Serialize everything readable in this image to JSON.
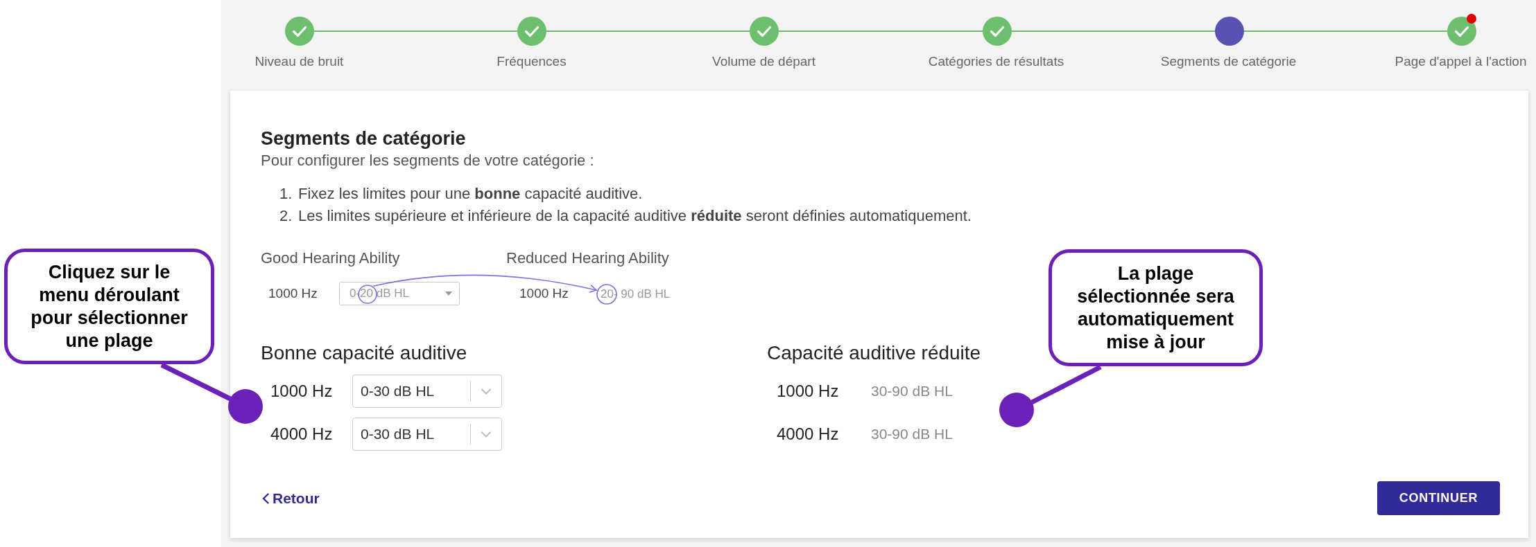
{
  "stepper": {
    "steps": [
      {
        "label": "Niveau de bruit",
        "completed": true,
        "selected": false,
        "alert": false
      },
      {
        "label": "Fréquences",
        "completed": true,
        "selected": false,
        "alert": false
      },
      {
        "label": "Volume de départ",
        "completed": true,
        "selected": false,
        "alert": false
      },
      {
        "label": "Catégories de résultats",
        "completed": true,
        "selected": false,
        "alert": false
      },
      {
        "label": "Segments de catégorie",
        "completed": false,
        "selected": true,
        "alert": false
      },
      {
        "label": "Page d'appel à l'action",
        "completed": true,
        "selected": false,
        "alert": true
      }
    ]
  },
  "card": {
    "title": "Segments de catégorie",
    "intro": "Pour configurer les segments de votre catégorie :",
    "instructions": [
      {
        "number": "1.",
        "text": "Fixez les limites pour une **bonne** capacité auditive."
      },
      {
        "number": "2.",
        "text": "Les limites supérieure et inférieure de la capacité auditive **réduite** seront définies automatiquement."
      }
    ],
    "example": {
      "columns": [
        {
          "title": "Good Hearing Ability",
          "rows": [
            {
              "frequency": "1000 Hz",
              "value": "0-20 dB HL",
              "kind": "dropdown"
            }
          ]
        },
        {
          "title": "Reduced Hearing Ability",
          "rows": [
            {
              "frequency": "1000 Hz",
              "value": "20- 90 dB HL",
              "kind": "text"
            }
          ]
        }
      ]
    },
    "form": {
      "columns": [
        {
          "title": "Bonne capacité auditive",
          "rows": [
            {
              "frequency": "1000 Hz",
              "value": "0-30 dB HL",
              "kind": "dropdown"
            },
            {
              "frequency": "4000 Hz",
              "value": "0-30 dB HL",
              "kind": "dropdown"
            }
          ]
        },
        {
          "title": "Capacité auditive réduite",
          "rows": [
            {
              "frequency": "1000 Hz",
              "value": "30-90 dB HL",
              "kind": "text"
            },
            {
              "frequency": "4000 Hz",
              "value": "30-90 dB HL",
              "kind": "text"
            }
          ]
        }
      ]
    },
    "back_link": "Retour",
    "continue_button": "CONTINUER"
  },
  "callouts": [
    {
      "text": "Cliquez sur le\nmenu déroulant\npour sélectionner\nune plage"
    },
    {
      "text": "La plage\nsélectionnée sera\nautomatiquement\nmise à jour"
    }
  ]
}
